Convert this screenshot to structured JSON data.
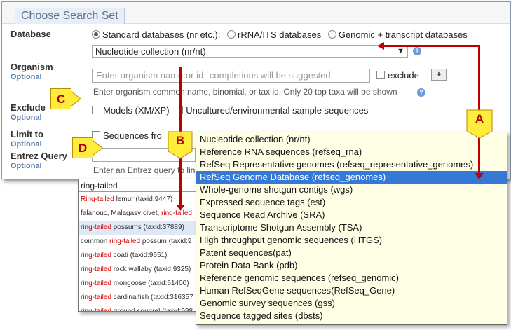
{
  "section_title": "Choose Search Set",
  "database": {
    "label": "Database",
    "radios": [
      "Standard databases (nr etc.):",
      "rRNA/ITS databases",
      "Genomic + transcript databases"
    ],
    "selected_value": "Nucleotide collection (nr/nt)",
    "arrow": "▼"
  },
  "organism": {
    "label": "Organism",
    "optional": "Optional",
    "placeholder": "Enter organism name or id--completions will be suggested",
    "exclude_label": "exclude",
    "plus": "+",
    "hint": "Enter organism common name, binomial, or tax id. Only 20 top taxa will be shown"
  },
  "exclude": {
    "label": "Exclude",
    "optional": "Optional",
    "opt1": "Models (XM/XP)",
    "opt2": "Uncultured/environmental sample sequences"
  },
  "limit": {
    "label": "Limit to",
    "optional": "Optional",
    "opt": "Sequences fro"
  },
  "entrez": {
    "label": "Entrez Query",
    "optional": "Optional",
    "hint": "Enter an Entrez query to lin"
  },
  "callouts": {
    "a": "A",
    "b": "B",
    "c": "C",
    "d": "D"
  },
  "help_glyph": "?",
  "dropdown": {
    "items": [
      "Nucleotide collection (nr/nt)",
      "Reference RNA sequences (refseq_rna)",
      "RefSeq Representative genomes (refseq_representative_genomes)",
      "RefSeq Genome Database (refseq_genomes)",
      "Whole-genome shotgun contigs (wgs)",
      "Expressed sequence tags (est)",
      "Sequence Read Archive (SRA)",
      "Transcriptome Shotgun Assembly (TSA)",
      "High throughput genomic sequences (HTGS)",
      "Patent sequences(pat)",
      "Protein Data Bank (pdb)",
      "Reference genomic sequences (refseq_genomic)",
      "Human RefSeqGene sequences(RefSeq_Gene)",
      "Genomic survey sequences (gss)",
      "Sequence tagged sites (dbsts)"
    ],
    "selected_index": 3
  },
  "autocomplete": {
    "query": "ring-tailed",
    "suggestions": [
      {
        "pre": "",
        "hit": "Ring-tailed",
        "post": " lemur (taxid:9447)"
      },
      {
        "pre": "falanouc, Malagasy civet, ",
        "hit": "ring-tailed",
        "post": ""
      },
      {
        "pre": "",
        "hit": "ring-tailed",
        "post": " possums (taxid:37889)"
      },
      {
        "pre": "common ",
        "hit": "ring-tailed",
        "post": " possum (taxid:9"
      },
      {
        "pre": "",
        "hit": "ring-tailed",
        "post": " coati (taxid:9651)"
      },
      {
        "pre": "",
        "hit": "ring-tailed",
        "post": " rock wallaby (taxid:9325)"
      },
      {
        "pre": "",
        "hit": "ring-tailed",
        "post": " mongoose (taxid:61400)"
      },
      {
        "pre": "",
        "hit": "ring-tailed",
        "post": " cardinalfish (taxid:316357"
      },
      {
        "pre": "",
        "hit": "ring-tailed",
        "post": " ground squirrel (taxid:998"
      }
    ],
    "highlighted_index": 2
  }
}
